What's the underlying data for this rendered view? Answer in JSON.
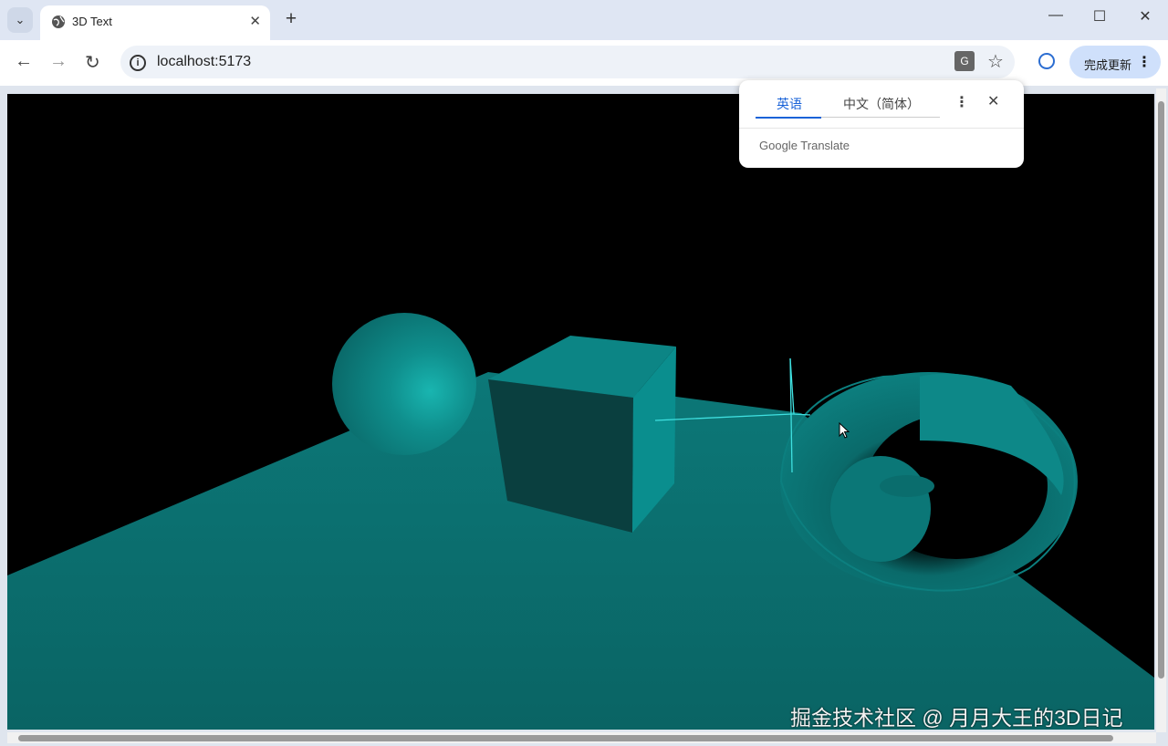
{
  "browser": {
    "tab_title": "3D Text",
    "tab_close": "✕",
    "new_tab": "+",
    "url": "localhost:5173",
    "update_button": "完成更新",
    "window_controls": {
      "minimize": "—",
      "maximize": "☐",
      "close": "✕"
    }
  },
  "translate_popup": {
    "source_lang": "英语",
    "target_lang": "中文（简体）",
    "footer": "Google Translate",
    "close": "✕"
  },
  "scene": {
    "background": "#000000",
    "accent": "#0e8a8a",
    "objects": [
      "sphere-mesh",
      "cube-mesh",
      "torus-mesh",
      "plane-mesh",
      "camera-helper"
    ]
  },
  "watermark": "掘金技术社区 @ 月月大王的3D日记"
}
